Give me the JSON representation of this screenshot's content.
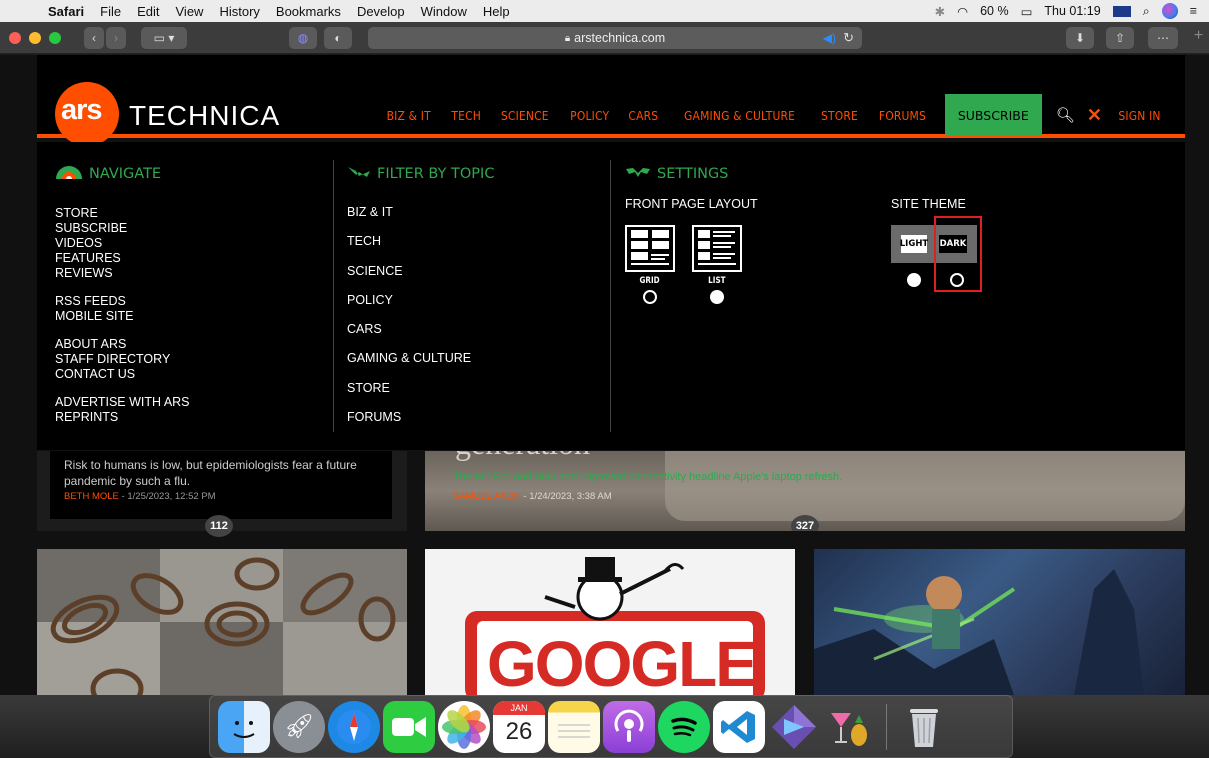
{
  "menubar": {
    "app": "Safari",
    "items": [
      "File",
      "Edit",
      "View",
      "History",
      "Bookmarks",
      "Develop",
      "Window",
      "Help"
    ],
    "battery": "60 %",
    "clock": "Thu 01:19"
  },
  "browser": {
    "url": "arstechnica.com"
  },
  "site": {
    "logo_ars": "ars",
    "logo_technica": "TECHNICA",
    "nav": [
      "BIZ & IT",
      "TECH",
      "SCIENCE",
      "POLICY",
      "CARS",
      "GAMING & CULTURE",
      "STORE",
      "FORUMS"
    ],
    "subscribe": "SUBSCRIBE",
    "sign_in": "SIGN IN",
    "accent_color": "#ff4e00",
    "green_color": "#2fa84f"
  },
  "menu": {
    "navigate": {
      "heading": "NAVIGATE",
      "group1": [
        "STORE",
        "SUBSCRIBE",
        "VIDEOS",
        "FEATURES",
        "REVIEWS"
      ],
      "group2": [
        "RSS FEEDS",
        "MOBILE SITE"
      ],
      "group3": [
        "ABOUT ARS",
        "STAFF DIRECTORY",
        "CONTACT US"
      ],
      "group4": [
        "ADVERTISE WITH ARS",
        "REPRINTS"
      ]
    },
    "filter": {
      "heading": "FILTER BY TOPIC",
      "items": [
        "BIZ & IT",
        "TECH",
        "SCIENCE",
        "POLICY",
        "CARS",
        "GAMING & CULTURE",
        "STORE",
        "FORUMS"
      ]
    },
    "settings": {
      "heading": "SETTINGS",
      "front_page_layout": "FRONT PAGE LAYOUT",
      "grid_label": "GRID",
      "list_label": "LIST",
      "layout_selected": "LIST",
      "site_theme": "SITE THEME",
      "light_label": "LIGHT",
      "dark_label": "DARK",
      "theme_selected": "LIGHT"
    }
  },
  "articles": {
    "a1": {
      "teaser": "Risk to humans is low, but epidemiologists fear a future pandemic by such a flu.",
      "author": "BETH MOLE",
      "date": "1/25/2023, 12:52 PM",
      "comments": "112"
    },
    "a2": {
      "headline_fragment": "generation",
      "teaser": "The M2 Pro and Max and improved connectivity headline Apple's laptop refresh.",
      "author": "SAMUEL AXON",
      "date": "1/24/2023, 3:38 AM",
      "comments": "327"
    },
    "a3": {
      "logo_text": "GOOGLE"
    }
  },
  "dock": {
    "apps": [
      "finder-icon",
      "launchpad-icon",
      "safari-icon",
      "facetime-icon",
      "photos-icon",
      "calendar-icon",
      "notes-icon",
      "podcasts-icon",
      "spotify-icon",
      "vscode-icon",
      "xcode-instruments-icon",
      "cocktail-icon"
    ],
    "calendar_month": "JAN",
    "calendar_day": "26"
  }
}
